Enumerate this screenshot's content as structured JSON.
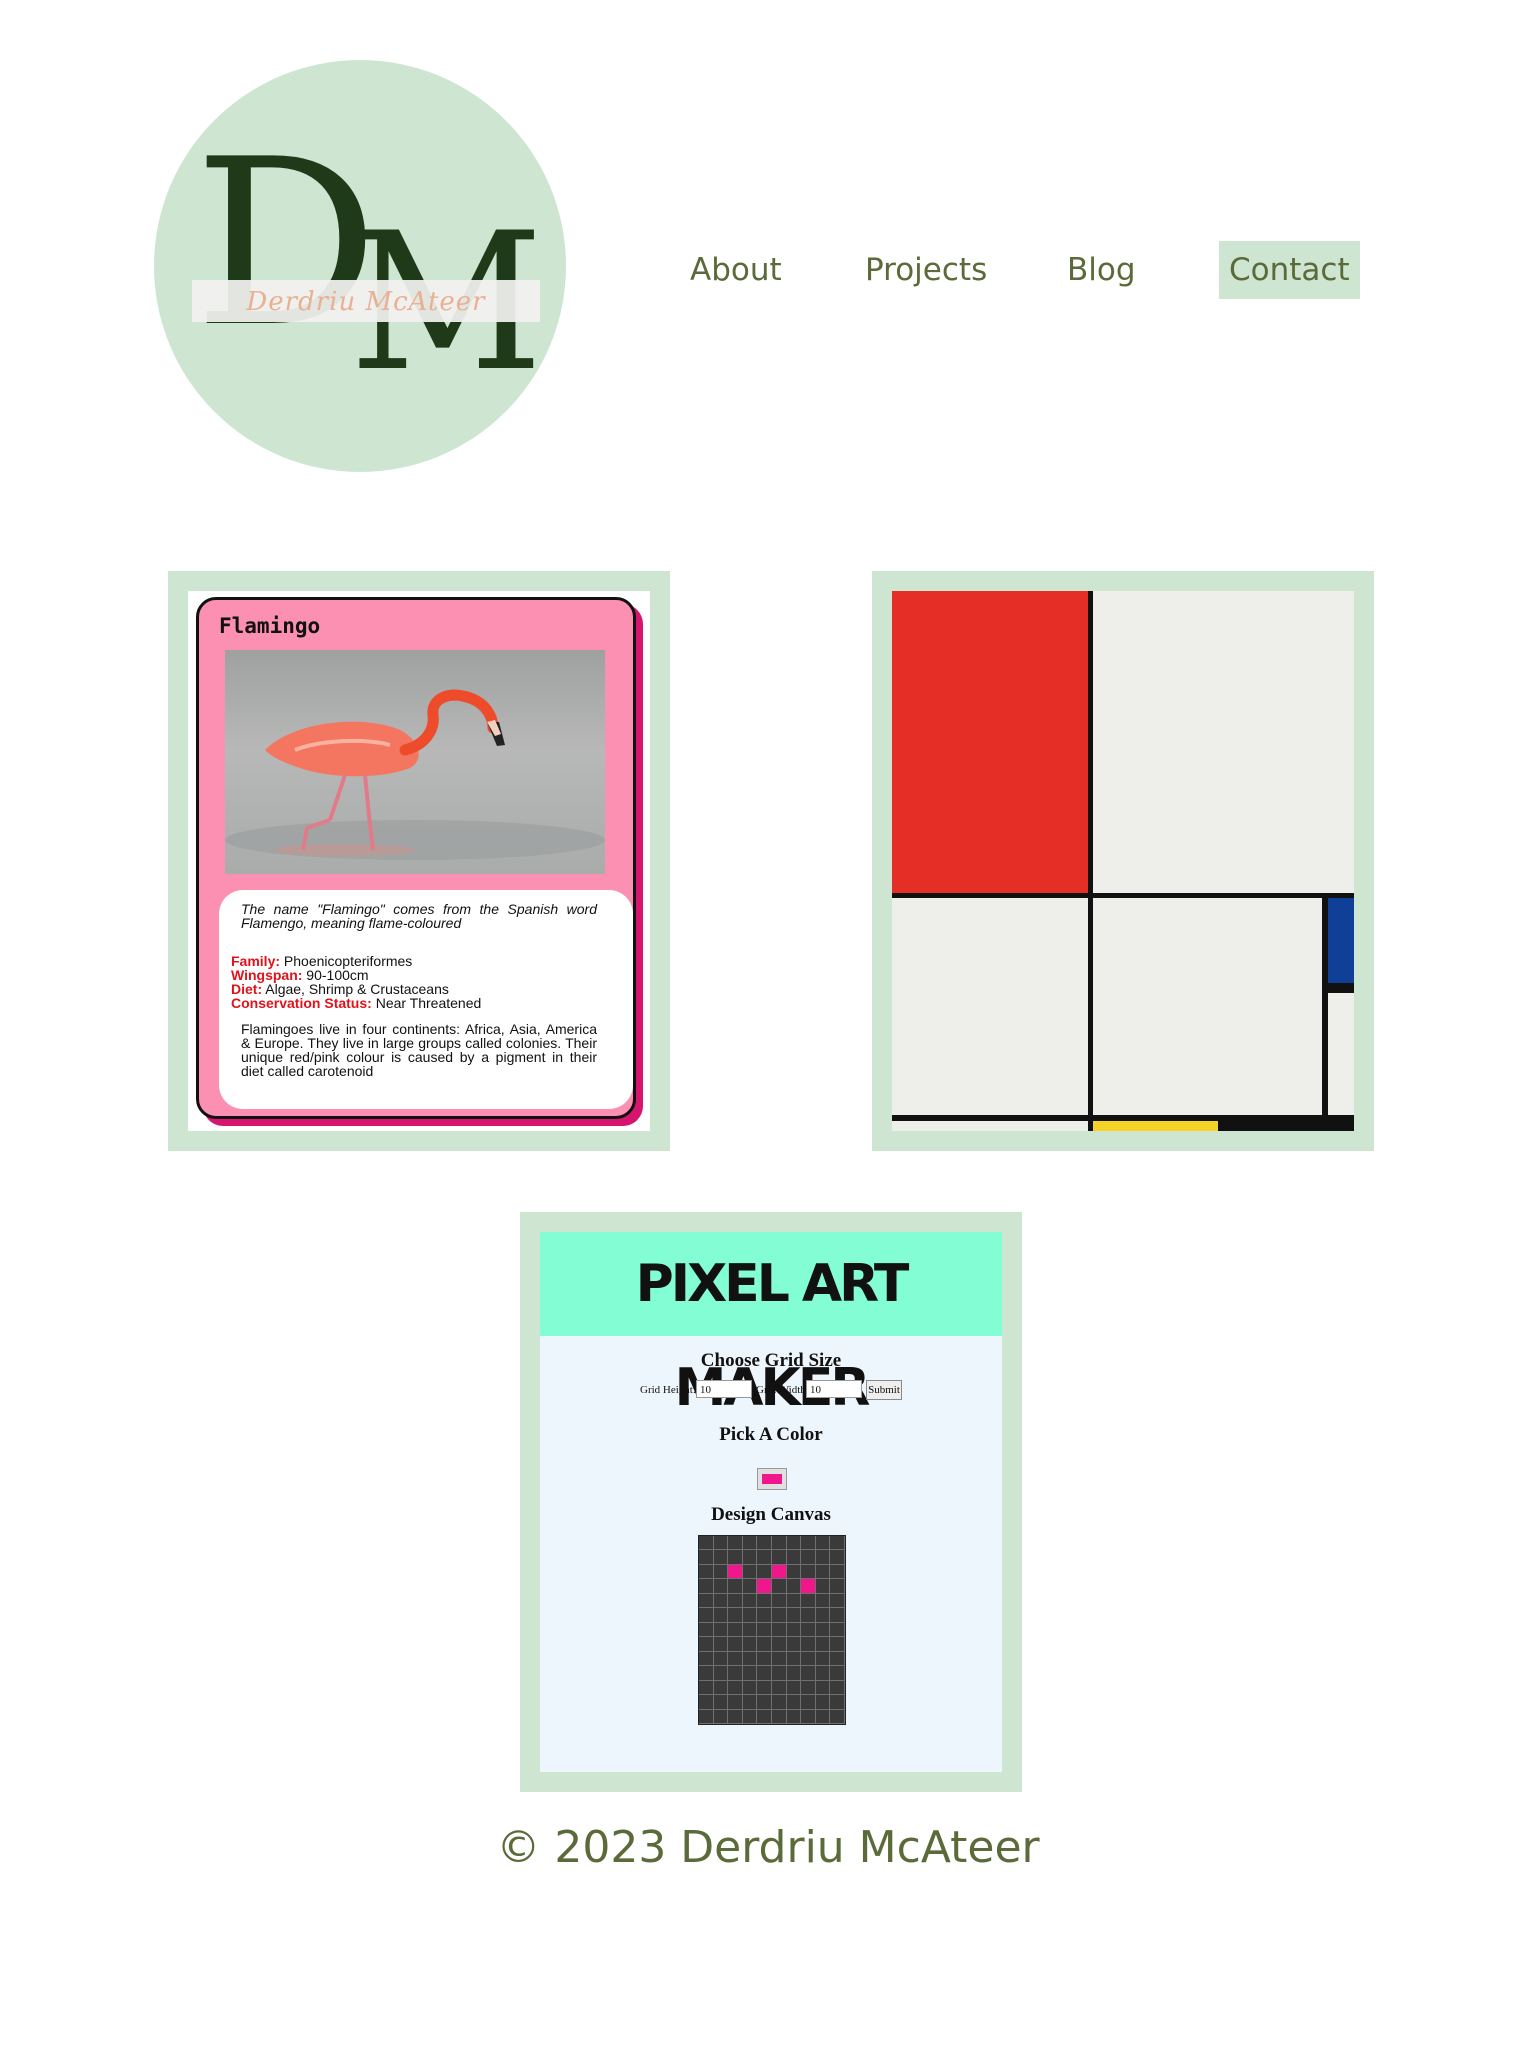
{
  "logo": {
    "monogram_d": "D",
    "monogram_m": "M",
    "name": "Derdriu McAteer"
  },
  "nav": {
    "items": [
      {
        "label": "About"
      },
      {
        "label": "Projects"
      },
      {
        "label": "Blog"
      },
      {
        "label": "Contact",
        "active": true
      }
    ]
  },
  "projects": {
    "flamingo": {
      "title": "Flamingo",
      "intro": "The name \"Flamingo\" comes from the Spanish word Flamengo, meaning flame-coloured",
      "facts": [
        {
          "key": "Family:",
          "value": " Phoenicopteriformes"
        },
        {
          "key": "Wingspan:",
          "value": " 90-100cm"
        },
        {
          "key": "Diet:",
          "value": " Algae, Shrimp & Crustaceans"
        },
        {
          "key": "Conservation Status:",
          "value": " Near Threatened"
        }
      ],
      "outro": "Flamingoes live in four continents: Africa, Asia, America & Europe. They live in large groups called colonies. Their unique red/pink colour is caused by a pigment in their diet called carotenoid"
    },
    "mondrian": {
      "colors": {
        "red": "#e52e25",
        "blue": "#0f3f96",
        "yellow": "#f5d327",
        "white": "#eeefeb",
        "line": "#111111"
      }
    },
    "pixel_art": {
      "banner": "PIXEL ART MAKER",
      "grid_heading": "Choose Grid Size",
      "height_label": "Grid Height:",
      "height_value": "10",
      "width_label": "Grid Width:",
      "width_value": "10",
      "submit_label": "Submit",
      "color_heading": "Pick A Color",
      "picked_color": "#f0168c",
      "canvas_heading": "Design Canvas"
    }
  },
  "footer": {
    "copyright": "© 2023 Derdriu McAteer"
  },
  "colors": {
    "accent": "#cde5d1",
    "text": "#5b6a39"
  }
}
